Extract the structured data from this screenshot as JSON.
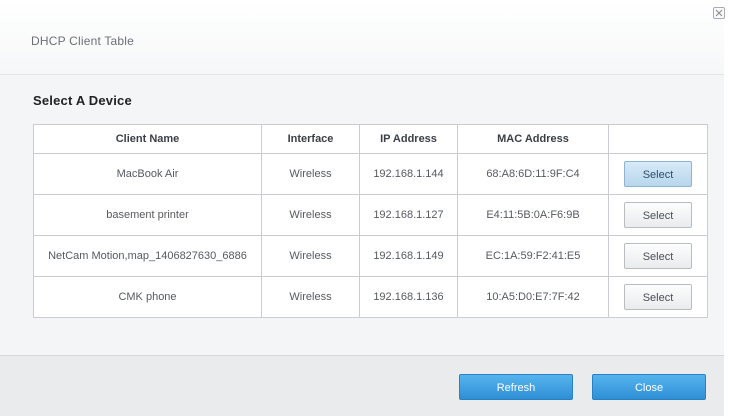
{
  "dialog": {
    "title": "DHCP Client Table",
    "section_title": "Select A Device"
  },
  "table": {
    "headers": [
      "Client Name",
      "Interface",
      "IP Address",
      "MAC Address",
      ""
    ],
    "rows": [
      {
        "name": "MacBook Air",
        "interface": "Wireless",
        "ip": "192.168.1.144",
        "mac": "68:A8:6D:11:9F:C4",
        "button": "Select"
      },
      {
        "name": "basement printer",
        "interface": "Wireless",
        "ip": "192.168.1.127",
        "mac": "E4:11:5B:0A:F6:9B",
        "button": "Select"
      },
      {
        "name": "NetCam Motion,map_1406827630_6886",
        "interface": "Wireless",
        "ip": "192.168.1.149",
        "mac": "EC:1A:59:F2:41:E5",
        "button": "Select"
      },
      {
        "name": "CMK phone",
        "interface": "Wireless",
        "ip": "192.168.1.136",
        "mac": "10:A5:D0:E7:7F:42",
        "button": "Select"
      }
    ]
  },
  "footer": {
    "refresh_label": "Refresh",
    "close_label": "Close"
  },
  "colors": {
    "accent": "#2f8fd6",
    "selected_button": "#b8d6ec"
  }
}
